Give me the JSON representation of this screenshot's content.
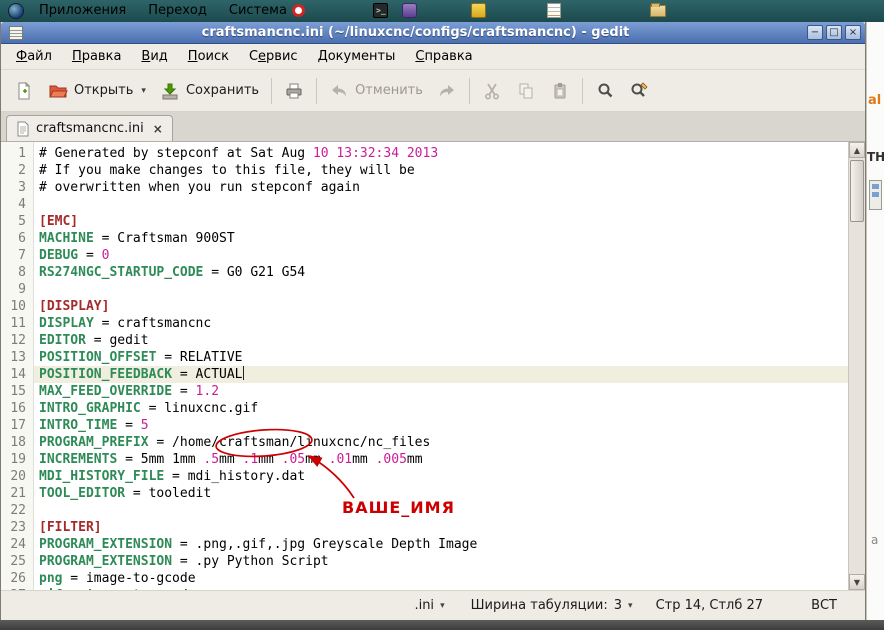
{
  "colors": {
    "panel_bg": "#235457",
    "titlebar_blue": "#5478ba",
    "chrome_bg": "#efebe5",
    "tabbar_bg": "#d9d6cf",
    "syntax_key": "#2e8b57",
    "syntax_section": "#a52a2a",
    "syntax_number": "#cb1d95",
    "syntax_plain": "#000000",
    "current_line_bg": "#f0efdf",
    "annotation_red": "#cc0000",
    "disabled_gray": "#9d9990"
  },
  "icons": {
    "minimize": "−",
    "maximize": "□",
    "close": "×",
    "tab_close": "×",
    "dropdown_caret": "▾",
    "scroll_up": "▲",
    "scroll_down": "▼",
    "terminal_prompt": ">_"
  },
  "desktop": {
    "panel_menus": [
      {
        "label": "Приложения"
      },
      {
        "label": "Переход"
      },
      {
        "label": "Система"
      }
    ],
    "background_window": {
      "fragments": [
        "al",
        "TH",
        "a"
      ]
    }
  },
  "window": {
    "title": "craftsmancnc.ini (~/linuxcnc/configs/craftsmancnc) - gedit",
    "menu_items": [
      {
        "label": "Файл",
        "accel_index": 0
      },
      {
        "label": "Правка",
        "accel_index": 0
      },
      {
        "label": "Вид",
        "accel_index": 0
      },
      {
        "label": "Поиск",
        "accel_index": 0
      },
      {
        "label": "Сервис",
        "accel_index": 1
      },
      {
        "label": "Документы",
        "accel_index": 0
      },
      {
        "label": "Справка",
        "accel_index": 0
      }
    ],
    "toolbar": {
      "open_label": "Открыть",
      "save_label": "Сохранить",
      "undo_label": "Отменить"
    },
    "tab_label": "craftsmancnc.ini",
    "statusbar": {
      "filetype": ".ini",
      "tab_width_label": "Ширина табуляции:",
      "tab_width_value": "3",
      "cursor_position": "Стр 14, Стлб 27",
      "insert_mode": "ВСТ"
    }
  },
  "editor": {
    "current_line": 14,
    "annotation_label": "ВАШЕ_ИМЯ",
    "lines": [
      [
        {
          "t": "# Generated by stepconf at Sat Aug ",
          "c": "plain"
        },
        {
          "t": "10 13:32:34 2013",
          "c": "num"
        }
      ],
      [
        {
          "t": "# If you make changes to this file, they will be",
          "c": "plain"
        }
      ],
      [
        {
          "t": "# overwritten when you run stepconf again",
          "c": "plain"
        }
      ],
      [],
      [
        {
          "t": "[EMC]",
          "c": "section"
        }
      ],
      [
        {
          "t": "MACHINE",
          "c": "key"
        },
        {
          "t": " = Craftsman 900ST",
          "c": "plain"
        }
      ],
      [
        {
          "t": "DEBUG",
          "c": "key"
        },
        {
          "t": " = ",
          "c": "plain"
        },
        {
          "t": "0",
          "c": "num"
        }
      ],
      [
        {
          "t": "RS274NGC_STARTUP_CODE",
          "c": "key"
        },
        {
          "t": " = G0 G21 G54",
          "c": "plain"
        }
      ],
      [],
      [
        {
          "t": "[DISPLAY]",
          "c": "section"
        }
      ],
      [
        {
          "t": "DISPLAY",
          "c": "key"
        },
        {
          "t": " = craftsmancnc",
          "c": "plain"
        }
      ],
      [
        {
          "t": "EDITOR",
          "c": "key"
        },
        {
          "t": " = gedit",
          "c": "plain"
        }
      ],
      [
        {
          "t": "POSITION_OFFSET",
          "c": "key"
        },
        {
          "t": " = RELATIVE",
          "c": "plain"
        }
      ],
      [
        {
          "t": "POSITION_FEEDBACK",
          "c": "key"
        },
        {
          "t": " = ACTUAL",
          "c": "plain"
        }
      ],
      [
        {
          "t": "MAX_FEED_OVERRIDE",
          "c": "key"
        },
        {
          "t": " = ",
          "c": "plain"
        },
        {
          "t": "1.2",
          "c": "num"
        }
      ],
      [
        {
          "t": "INTRO_GRAPHIC",
          "c": "key"
        },
        {
          "t": " = linuxcnc.gif",
          "c": "plain"
        }
      ],
      [
        {
          "t": "INTRO_TIME",
          "c": "key"
        },
        {
          "t": " = ",
          "c": "plain"
        },
        {
          "t": "5",
          "c": "num"
        }
      ],
      [
        {
          "t": "PROGRAM_PREFIX",
          "c": "key"
        },
        {
          "t": " = /home/craftsman/linuxcnc/nc_files",
          "c": "plain"
        }
      ],
      [
        {
          "t": "INCREMENTS",
          "c": "key"
        },
        {
          "t": " = 5mm 1mm ",
          "c": "plain"
        },
        {
          "t": ".5",
          "c": "num"
        },
        {
          "t": "mm ",
          "c": "plain"
        },
        {
          "t": ".1",
          "c": "num"
        },
        {
          "t": "mm ",
          "c": "plain"
        },
        {
          "t": ".05",
          "c": "num"
        },
        {
          "t": "mm ",
          "c": "plain"
        },
        {
          "t": ".01",
          "c": "num"
        },
        {
          "t": "mm ",
          "c": "plain"
        },
        {
          "t": ".005",
          "c": "num"
        },
        {
          "t": "mm",
          "c": "plain"
        }
      ],
      [
        {
          "t": "MDI_HISTORY_FILE",
          "c": "key"
        },
        {
          "t": " = mdi_history.dat",
          "c": "plain"
        }
      ],
      [
        {
          "t": "TOOL_EDITOR",
          "c": "key"
        },
        {
          "t": " = tooledit",
          "c": "plain"
        }
      ],
      [],
      [
        {
          "t": "[FILTER]",
          "c": "section"
        }
      ],
      [
        {
          "t": "PROGRAM_EXTENSION",
          "c": "key"
        },
        {
          "t": " = .png,.gif,.jpg Greyscale Depth Image",
          "c": "plain"
        }
      ],
      [
        {
          "t": "PROGRAM_EXTENSION",
          "c": "key"
        },
        {
          "t": " = .py Python Script",
          "c": "plain"
        }
      ],
      [
        {
          "t": "png",
          "c": "key"
        },
        {
          "t": " = image-to-gcode",
          "c": "plain"
        }
      ],
      [
        {
          "t": "gif",
          "c": "key"
        },
        {
          "t": " = image-to-gcode",
          "c": "plain"
        }
      ]
    ]
  }
}
